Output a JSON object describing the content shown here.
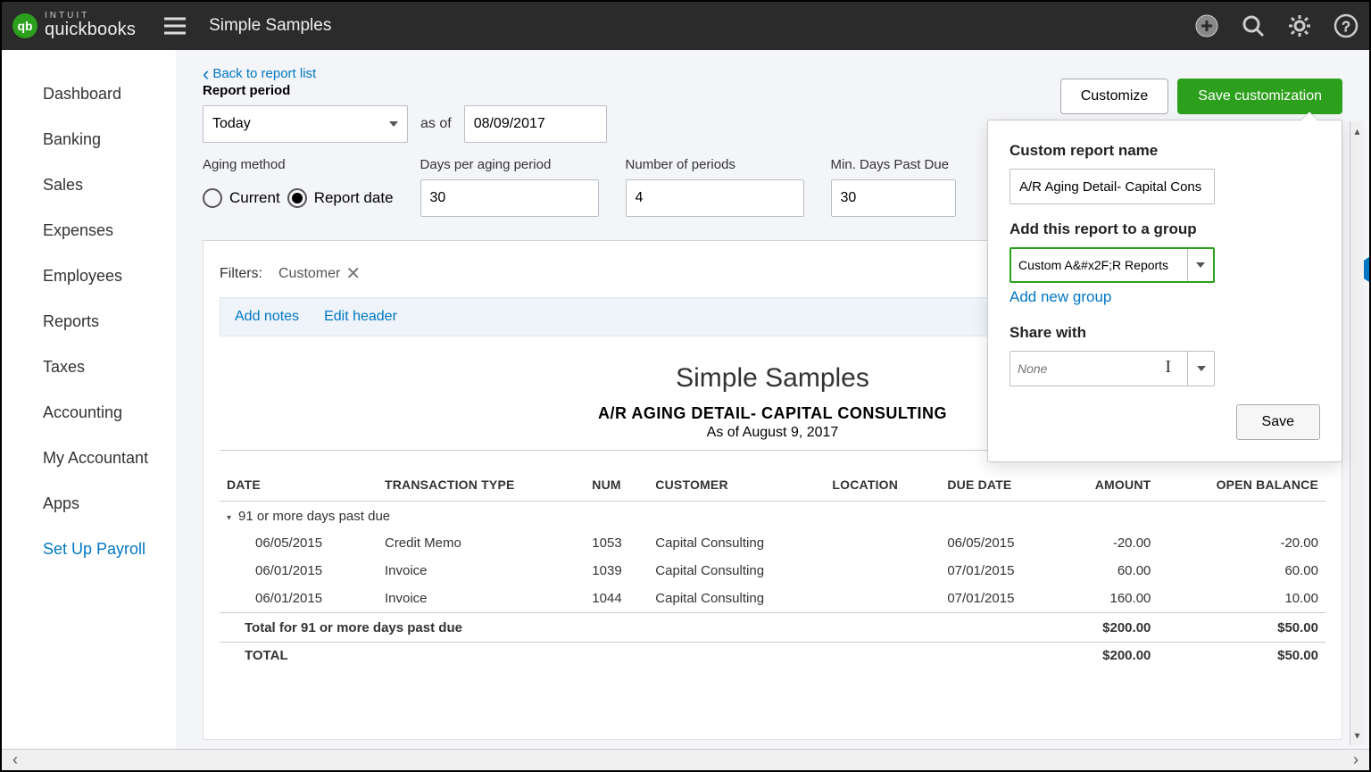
{
  "topbar": {
    "brand_intuit": "INTUIT",
    "brand": "quickbooks",
    "company": "Simple Samples"
  },
  "sidebar": {
    "items": [
      "Dashboard",
      "Banking",
      "Sales",
      "Expenses",
      "Employees",
      "Reports",
      "Taxes",
      "Accounting",
      "My Accountant",
      "Apps",
      "Set Up Payroll"
    ]
  },
  "back_link": "Back to report list",
  "report_period_label": "Report period",
  "period_select": "Today",
  "as_of_label": "as of",
  "as_of_date": "08/09/2017",
  "aging_method_label": "Aging method",
  "aging_current": "Current",
  "aging_report_date": "Report date",
  "days_per_label": "Days per aging period",
  "days_per_value": "30",
  "num_periods_label": "Number of periods",
  "num_periods_value": "4",
  "min_days_label": "Min. Days Past Due",
  "min_days_value": "30",
  "customize_btn": "Customize",
  "save_cust_btn": "Save customization",
  "filters_label": "Filters:",
  "filter_name": "Customer",
  "add_notes": "Add notes",
  "edit_header": "Edit header",
  "report_title": "Simple Samples",
  "report_subtitle": "A/R AGING DETAIL- CAPITAL CONSULTING",
  "report_asof": "As of August 9, 2017",
  "columns": [
    "DATE",
    "TRANSACTION TYPE",
    "NUM",
    "CUSTOMER",
    "LOCATION",
    "DUE DATE",
    "AMOUNT",
    "OPEN BALANCE"
  ],
  "group_header": "91 or more days past due",
  "rows": [
    {
      "date": "06/05/2015",
      "type": "Credit Memo",
      "num": "1053",
      "customer": "Capital Consulting",
      "location": "",
      "due": "06/05/2015",
      "amount": "-20.00",
      "open": "-20.00"
    },
    {
      "date": "06/01/2015",
      "type": "Invoice",
      "num": "1039",
      "customer": "Capital Consulting",
      "location": "",
      "due": "07/01/2015",
      "amount": "60.00",
      "open": "60.00"
    },
    {
      "date": "06/01/2015",
      "type": "Invoice",
      "num": "1044",
      "customer": "Capital Consulting",
      "location": "",
      "due": "07/01/2015",
      "amount": "160.00",
      "open": "10.00"
    }
  ],
  "subtotal": {
    "label": "Total for 91 or more days past due",
    "amount": "$200.00",
    "open": "$50.00"
  },
  "total": {
    "label": "TOTAL",
    "amount": "$200.00",
    "open": "$50.00"
  },
  "popover": {
    "name_label": "Custom report name",
    "name_value": "A/R Aging Detail- Capital Cons",
    "group_label": "Add this report to a group",
    "group_value": "Custom A&#x2F;R Reports",
    "add_new_group": "Add new group",
    "share_label": "Share with",
    "share_placeholder": "None",
    "save": "Save"
  }
}
